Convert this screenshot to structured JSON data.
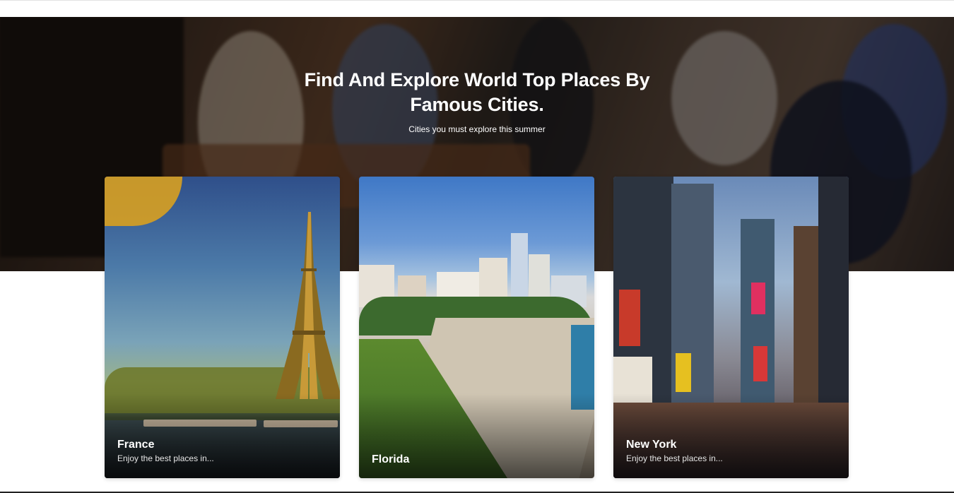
{
  "hero": {
    "title_line1": "Find And Explore World Top Places By",
    "title_line2": "Famous Cities.",
    "subtitle": "Cities you must explore this summer"
  },
  "cards": [
    {
      "name": "France",
      "description": "Enjoy the best places in..."
    },
    {
      "name": "Florida",
      "description": ""
    },
    {
      "name": "New York",
      "description": "Enjoy the best places in..."
    }
  ]
}
